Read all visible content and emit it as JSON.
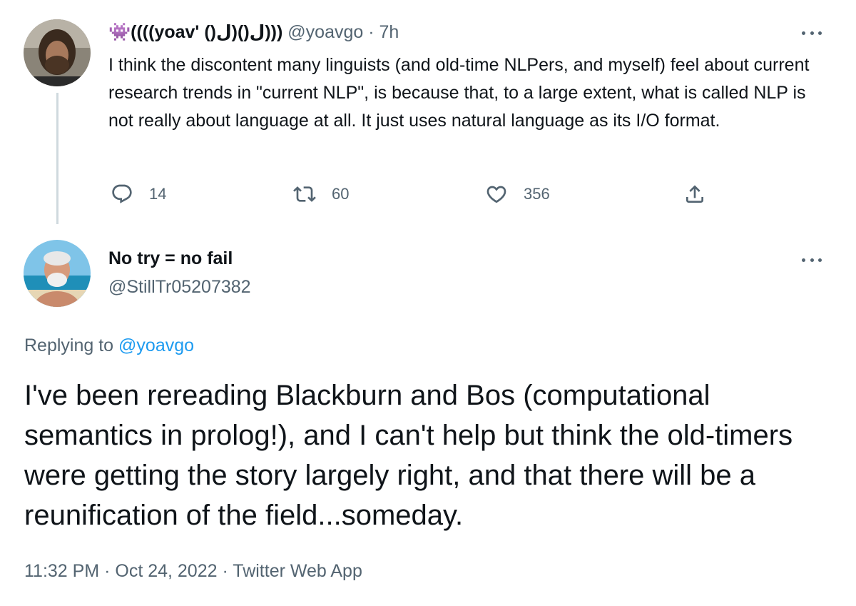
{
  "parent_tweet": {
    "emoji": "👾",
    "display_name": "((((yoav' ()ل)()ل)))",
    "handle": "@yoavgo",
    "separator": " · ",
    "time": "7h",
    "text": "I think the discontent many linguists (and old-time NLPers, and myself) feel about current research trends in \"current NLP\", is because that, to a large extent, what is called NLP is not really about language at all. It just uses natural language as its I/O format.",
    "replies_count": "14",
    "retweets_count": "60",
    "likes_count": "356"
  },
  "main_tweet": {
    "display_name": "No try = no fail",
    "handle": "@StillTr05207382",
    "replying_prefix": "Replying to ",
    "replying_to": "@yoavgo",
    "text": "I've been rereading Blackburn and Bos (computational semantics in prolog!), and I can't help but think the old-timers were getting the story largely right, and that there will be a reunification of the field...someday.",
    "timestamp": "11:32 PM · Oct 24, 2022 · ",
    "source": "Twitter Web App"
  },
  "icons": {
    "reply": "reply-icon",
    "retweet": "retweet-icon",
    "like": "heart-icon",
    "share": "share-icon",
    "more": "more-icon"
  },
  "colors": {
    "text": "#0f1419",
    "secondary": "#536471",
    "link": "#1d9bf0",
    "thread_line": "#cfd9de"
  }
}
